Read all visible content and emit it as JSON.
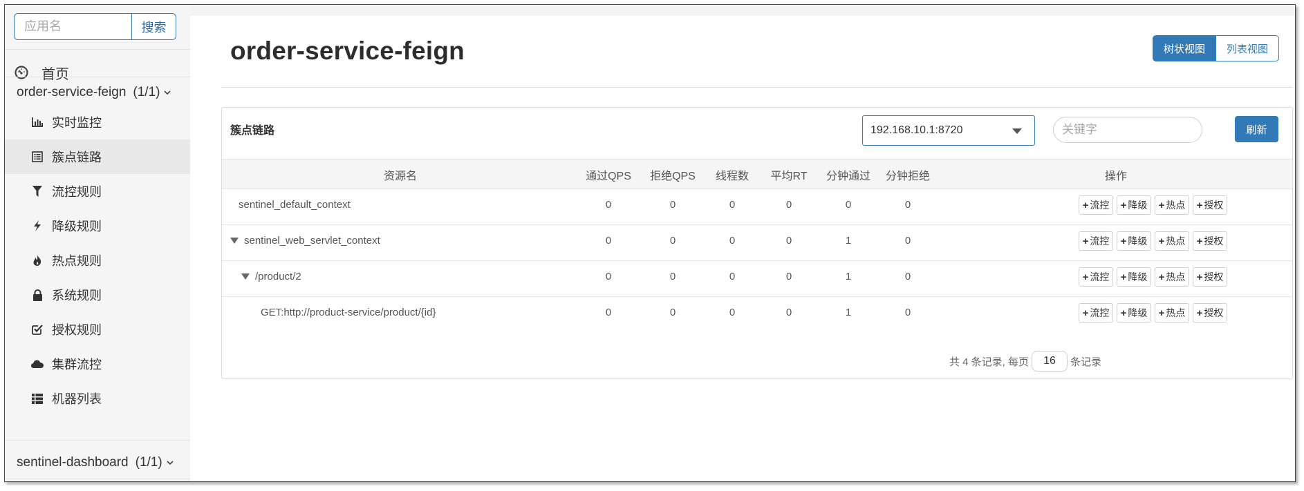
{
  "sidebar": {
    "search": {
      "placeholder": "应用名",
      "button": "搜索"
    },
    "home": "首页",
    "apps": [
      {
        "name": "order-service-feign",
        "count": "(1/1)",
        "expanded": true,
        "menu": [
          {
            "label": "实时监控",
            "icon": "bar-chart-icon"
          },
          {
            "label": "簇点链路",
            "icon": "list-icon",
            "active": true
          },
          {
            "label": "流控规则",
            "icon": "filter-icon"
          },
          {
            "label": "降级规则",
            "icon": "flash-icon"
          },
          {
            "label": "热点规则",
            "icon": "fire-icon"
          },
          {
            "label": "系统规则",
            "icon": "lock-icon"
          },
          {
            "label": "授权规则",
            "icon": "check-icon"
          },
          {
            "label": "集群流控",
            "icon": "cloud-icon"
          },
          {
            "label": "机器列表",
            "icon": "th-list-icon"
          }
        ]
      },
      {
        "name": "sentinel-dashboard",
        "count": "(1/1)",
        "expanded": false
      }
    ]
  },
  "main": {
    "title": "order-service-feign",
    "view_toggle": {
      "tree": "树状视图",
      "list": "列表视图",
      "active": "tree"
    },
    "panel": {
      "title": "簇点链路",
      "machine": "192.168.10.1:8720",
      "keyword_placeholder": "关键字",
      "refresh": "刷新",
      "columns": [
        "资源名",
        "通过QPS",
        "拒绝QPS",
        "线程数",
        "平均RT",
        "分钟通过",
        "分钟拒绝",
        "操作"
      ],
      "rows": [
        {
          "name": "sentinel_default_context",
          "level": 0,
          "toggle": false,
          "values": [
            "0",
            "0",
            "0",
            "0",
            "0",
            "0"
          ]
        },
        {
          "name": "sentinel_web_servlet_context",
          "level": 0,
          "toggle": true,
          "values": [
            "0",
            "0",
            "0",
            "0",
            "1",
            "0"
          ]
        },
        {
          "name": "/product/2",
          "level": 1,
          "toggle": true,
          "values": [
            "0",
            "0",
            "0",
            "0",
            "1",
            "0"
          ]
        },
        {
          "name": "GET:http://product-service/product/{id}",
          "level": 2,
          "toggle": false,
          "values": [
            "0",
            "0",
            "0",
            "0",
            "1",
            "0"
          ]
        }
      ],
      "actions": [
        "流控",
        "降级",
        "热点",
        "授权"
      ],
      "pager": {
        "prefix": "共 4 条记录, 每页",
        "page_size": "16",
        "suffix": "条记录"
      }
    }
  },
  "colors": {
    "primary": "#3279b7",
    "active_menu_bg": "#e8e8e8"
  }
}
